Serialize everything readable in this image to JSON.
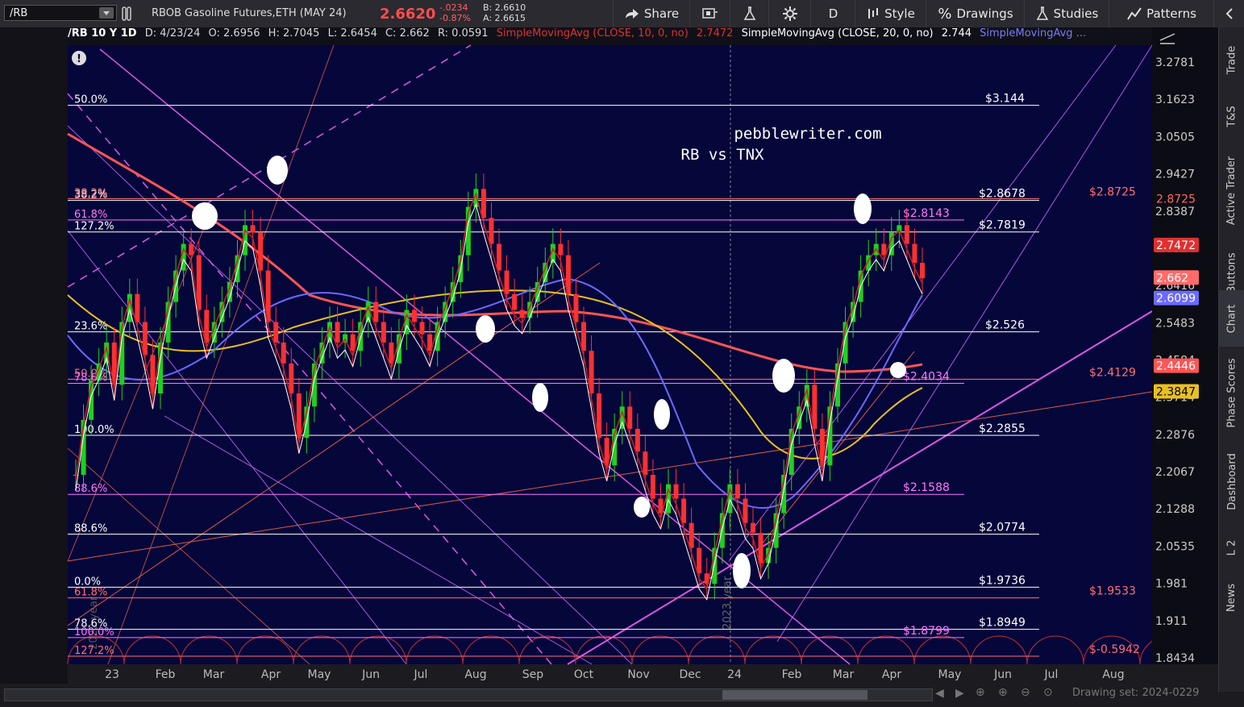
{
  "toolbar": {
    "symbol": "/RB",
    "instrument_name": "RBOB Gasoline Futures,ETH (MAY 24)",
    "last_price": "2.6620",
    "net_change": "-.0234",
    "pct_change": "-0.87%",
    "bid": "B: 2.6610",
    "ask": "A: 2.6615",
    "share_label": "Share",
    "period_label": "D",
    "style_label": "Style",
    "drawings_label": "Drawings",
    "studies_label": "Studies",
    "patterns_label": "Patterns"
  },
  "info": {
    "symbol_period": "/RB 10 Y 1D",
    "date": "D: 4/23/24",
    "open": "O: 2.6956",
    "high": "H: 2.7045",
    "low": "L: 2.6454",
    "close": "C: 2.662",
    "range": "R: 0.0591",
    "sma10_label": "SimpleMovingAvg (CLOSE, 10, 0, no)",
    "sma10_value": "2.7472",
    "sma20_label": "SimpleMovingAvg (CLOSE, 20, 0, no)",
    "sma20_value": "2.744",
    "sma3_label": "SimpleMovingAvg ..."
  },
  "sidebar": {
    "tabs": [
      "Trade",
      "T&S",
      "Active Trader",
      "Buttons",
      "Chart",
      "Phase Scores",
      "Dashboard",
      "L 2",
      "News"
    ]
  },
  "bottom": {
    "drawing_set": "Drawing set: 2024-0229"
  },
  "chart_data": {
    "type": "candlestick",
    "title": "pebblewriter.com",
    "subtitle": "RB vs TNX",
    "x_ticks": [
      "23",
      "Feb",
      "Mar",
      "Apr",
      "May",
      "Jun",
      "Jul",
      "Aug",
      "Sep",
      "Oct",
      "Nov",
      "Dec",
      "24",
      "Feb",
      "Mar",
      "Apr",
      "May",
      "Jun",
      "Jul",
      "Aug"
    ],
    "y_ticks": [
      3.2781,
      3.1623,
      3.0505,
      2.9427,
      2.8387,
      2.7384,
      2.6416,
      2.5483,
      2.4584,
      2.3714,
      2.2876,
      2.2067,
      2.1288,
      2.0535,
      1.981,
      1.911,
      1.8434
    ],
    "ylim": [
      1.8434,
      3.2781
    ],
    "y_scale": "log",
    "vertical_label": "2023 year",
    "vertical_label_left": "2022 year",
    "price_tags": [
      {
        "value": "2.8725",
        "color": "#ff6a6a"
      },
      {
        "value": "2.7472",
        "color": "#e03030"
      },
      {
        "value": "2.662",
        "color": "#ff6a6a"
      },
      {
        "value": "2.6099",
        "color": "#6a6aff"
      },
      {
        "value": "2.4446",
        "color": "#ff5555"
      },
      {
        "value": "2.3847",
        "color": "#e8c020"
      }
    ],
    "levels": [
      {
        "price": 3.144,
        "label": "$3.144",
        "pct": "50.0%",
        "color": "#ffffff"
      },
      {
        "price": 2.8678,
        "label": "$2.8678",
        "pct": "38.2%",
        "color": "#ffffff"
      },
      {
        "price": 2.8725,
        "label": "$2.8725",
        "pct": "38.2%",
        "color": "#ff7070"
      },
      {
        "price": 2.8143,
        "label": "$2.8143",
        "pct": "61.8%",
        "color": "#ff77ff"
      },
      {
        "price": 2.7819,
        "label": "$2.7819",
        "pct": "127.2%",
        "color": "#ffffff"
      },
      {
        "price": 2.526,
        "label": "$2.526",
        "pct": "23.6%",
        "color": "#ffffff"
      },
      {
        "price": 2.4129,
        "label": "$2.4129",
        "pct": "50.0%",
        "color": "#ff7070"
      },
      {
        "price": 2.4034,
        "label": "$2.4034",
        "pct": "78.6%",
        "color": "#ff77ff"
      },
      {
        "price": 2.2855,
        "label": "$2.2855",
        "pct": "100.0%",
        "color": "#ffffff"
      },
      {
        "price": 2.1588,
        "label": "$2.1588",
        "pct": "88.6%",
        "color": "#ff77ff"
      },
      {
        "price": 2.0774,
        "label": "$2.0774",
        "pct": "88.6%",
        "color": "#ffffff"
      },
      {
        "price": 1.9736,
        "label": "$1.9736",
        "pct": "0.0%",
        "color": "#ffffff"
      },
      {
        "price": 1.9533,
        "label": "$1.9533",
        "pct": "61.8%",
        "color": "#ff7070"
      },
      {
        "price": 1.8949,
        "label": "$1.8949",
        "pct": "78.6%",
        "color": "#ffffff"
      },
      {
        "price": 1.8799,
        "label": "$1.8799",
        "pct": "100.0%",
        "color": "#ff77ff"
      },
      {
        "price": -0.5942,
        "label": "$-0.5942",
        "pct": "127.2%",
        "color": "#ff7070"
      }
    ],
    "close_series": [
      2.2,
      2.32,
      2.41,
      2.45,
      2.5,
      2.4,
      2.55,
      2.62,
      2.55,
      2.47,
      2.38,
      2.5,
      2.6,
      2.68,
      2.75,
      2.72,
      2.58,
      2.5,
      2.55,
      2.6,
      2.65,
      2.72,
      2.8,
      2.78,
      2.68,
      2.55,
      2.5,
      2.45,
      2.38,
      2.28,
      2.35,
      2.45,
      2.5,
      2.55,
      2.5,
      2.52,
      2.48,
      2.55,
      2.6,
      2.55,
      2.5,
      2.45,
      2.52,
      2.58,
      2.55,
      2.52,
      2.48,
      2.55,
      2.6,
      2.65,
      2.72,
      2.85,
      2.9,
      2.82,
      2.75,
      2.68,
      2.62,
      2.58,
      2.56,
      2.6,
      2.65,
      2.7,
      2.75,
      2.72,
      2.62,
      2.55,
      2.48,
      2.38,
      2.28,
      2.22,
      2.3,
      2.35,
      2.3,
      2.25,
      2.2,
      2.15,
      2.12,
      2.18,
      2.15,
      2.1,
      2.05,
      2.0,
      1.98,
      2.05,
      2.12,
      2.18,
      2.15,
      2.1,
      2.08,
      2.02,
      2.05,
      2.12,
      2.2,
      2.3,
      2.35,
      2.4,
      2.3,
      2.22,
      2.35,
      2.45,
      2.55,
      2.6,
      2.68,
      2.72,
      2.75,
      2.72,
      2.78,
      2.8,
      2.75,
      2.7,
      2.66
    ]
  }
}
